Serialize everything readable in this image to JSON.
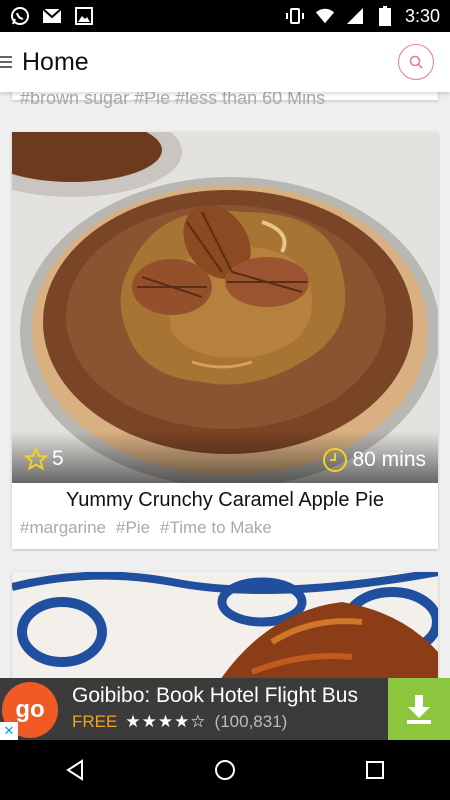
{
  "status_bar": {
    "time": "3:30",
    "left_icons": [
      "whatsapp-icon",
      "gmail-icon",
      "gallery-icon"
    ],
    "right_icons": [
      "vibrate-icon",
      "wifi-icon",
      "signal-icon",
      "battery-icon"
    ]
  },
  "app_bar": {
    "title": "Home",
    "menu_icon": "menu-icon",
    "search_icon": "search-icon",
    "accent": "#e8799a"
  },
  "previous_card": {
    "tags": "#brown sugar  #Pie  #less than 60 Mins"
  },
  "recipe_card": {
    "rating": "5",
    "time": "80 mins",
    "title": "Yummy Crunchy Caramel Apple Pie",
    "tags": [
      "#margarine",
      "#Pie",
      "#Time to Make"
    ],
    "star_color": "#f5d21f",
    "clock_color": "#f5d21f"
  },
  "ad": {
    "logo_text": "go",
    "title": "Goibibo: Book Hotel Flight Bus",
    "price": "FREE",
    "stars": "★★★★☆",
    "reviews": "(100,831)",
    "download_icon": "download-icon",
    "close_icon": "close-icon",
    "colors": {
      "logo": "#f15a24",
      "download": "#8cc63f",
      "free": "#f7a21b"
    }
  },
  "nav_bar": {
    "buttons": [
      "back-icon",
      "home-icon",
      "recents-icon"
    ]
  }
}
